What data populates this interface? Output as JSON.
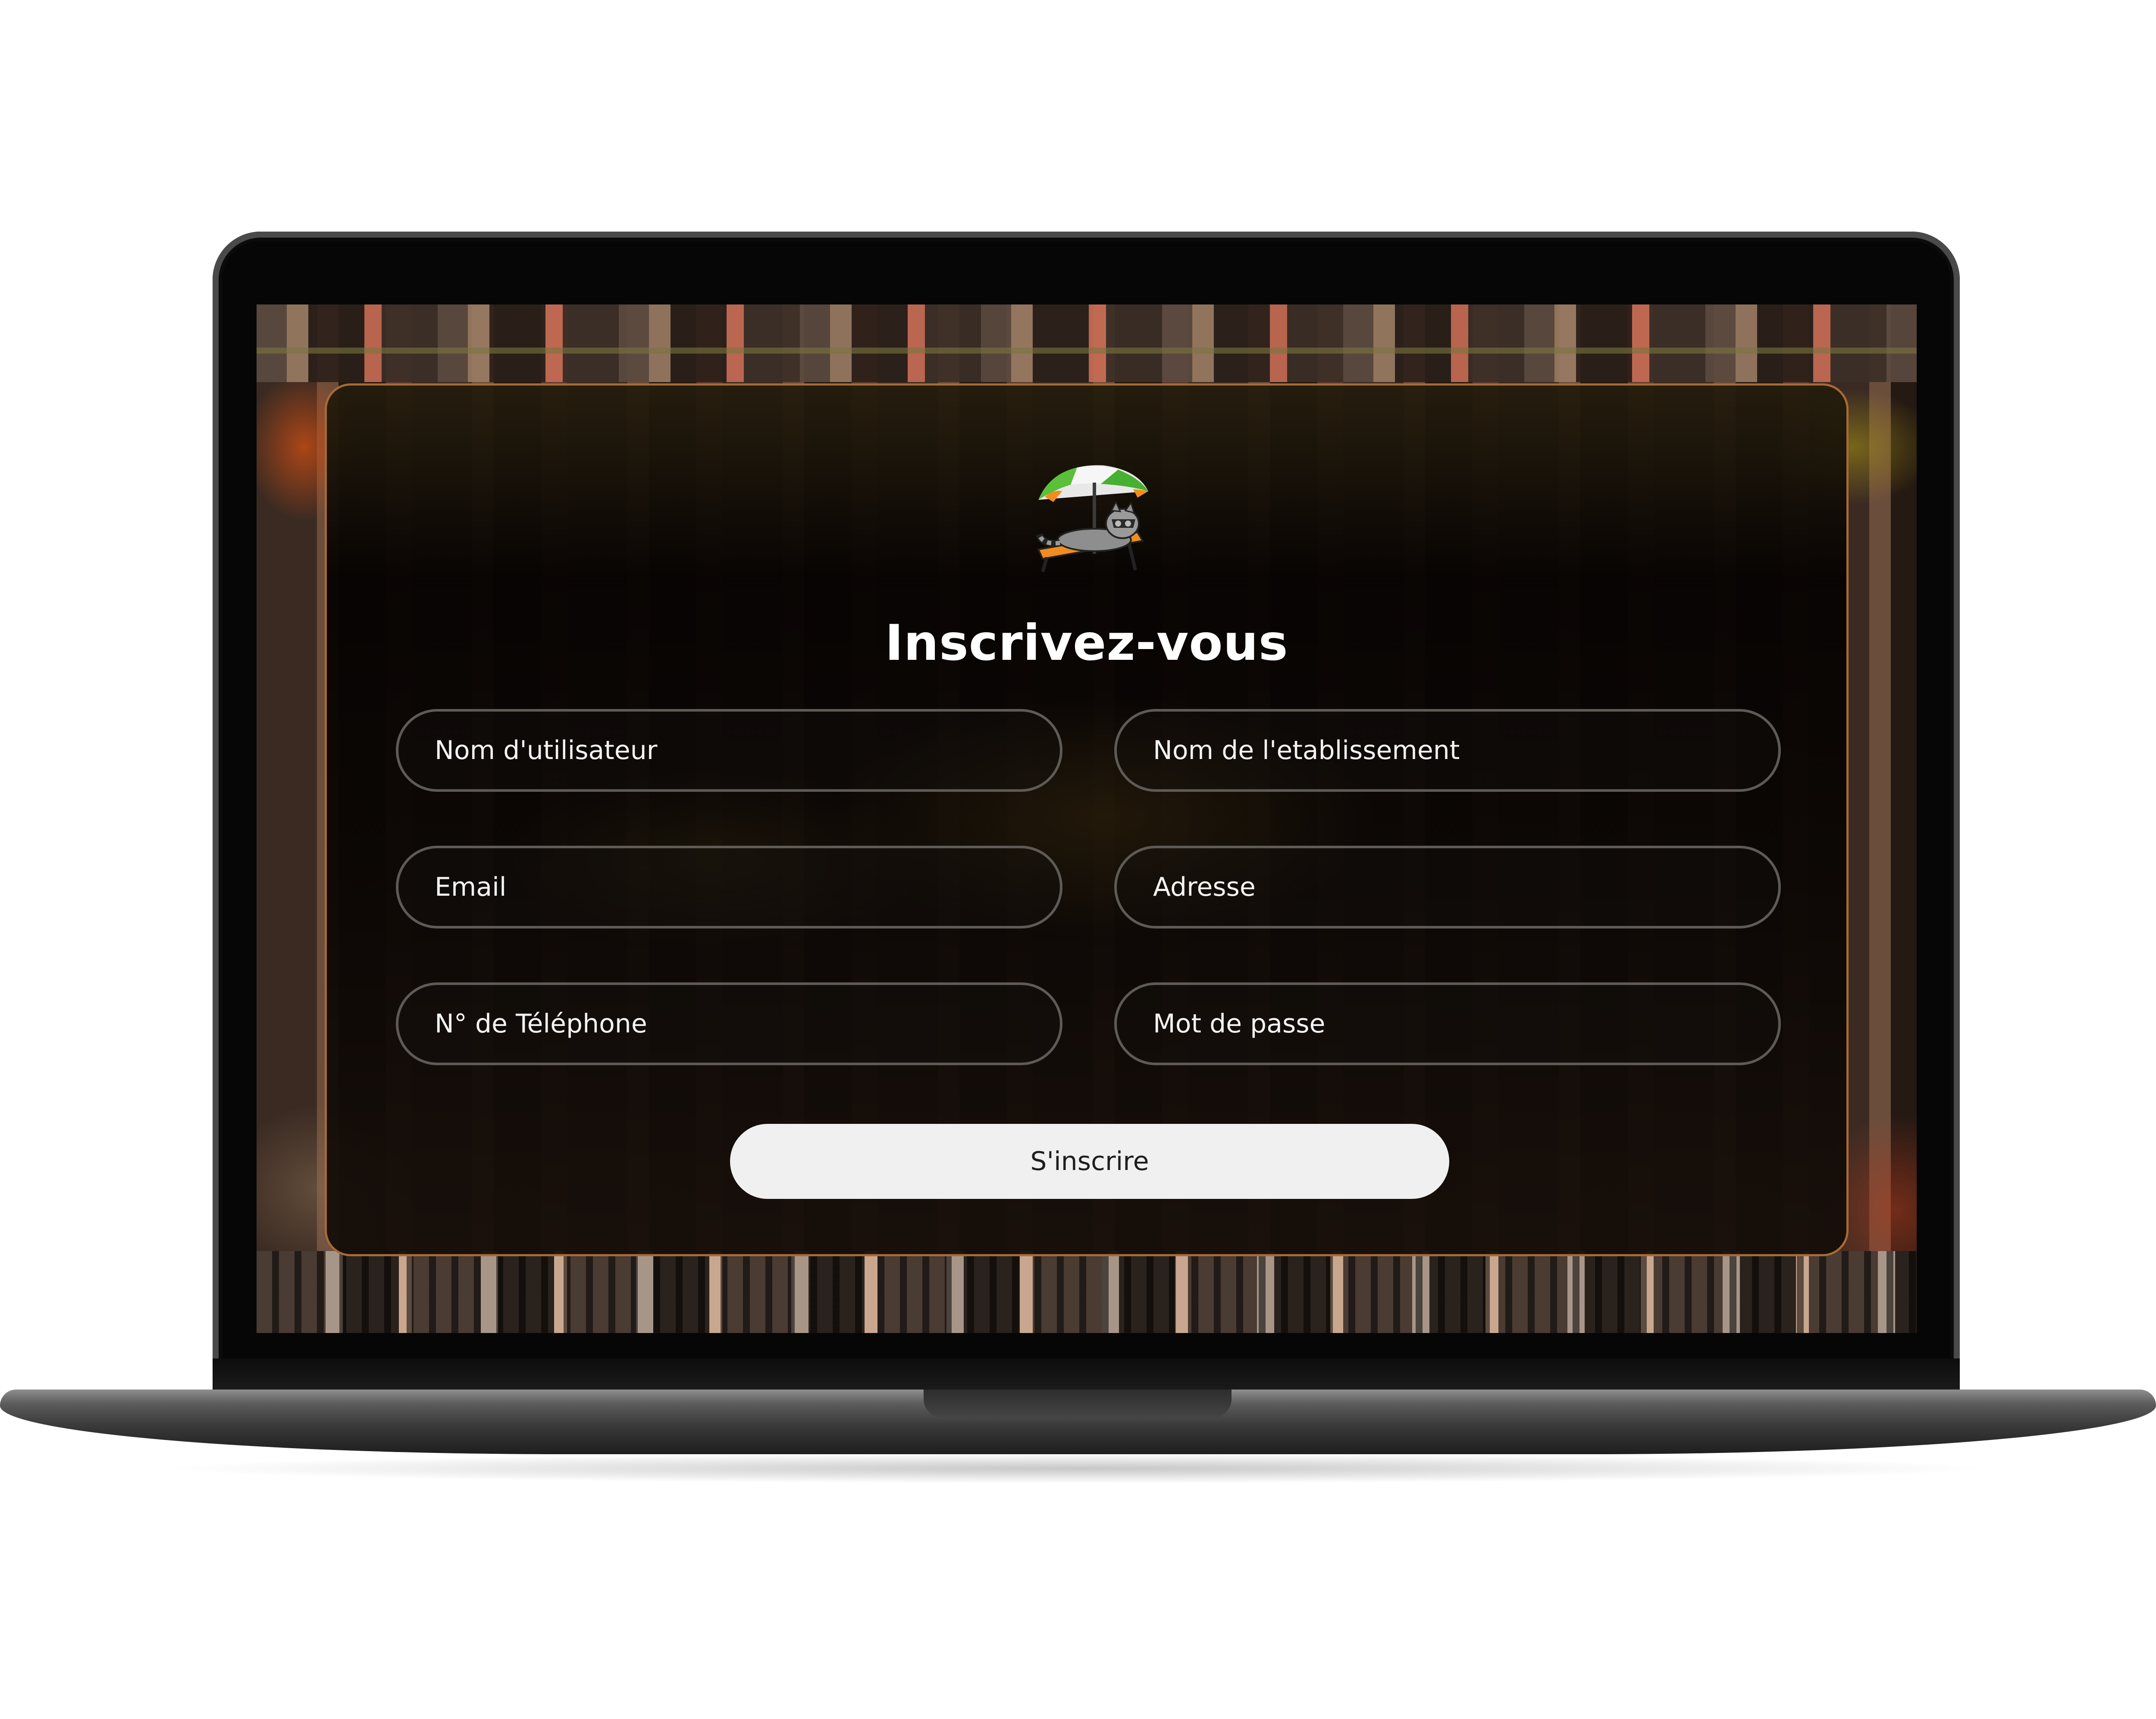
{
  "page": {
    "title": "Inscrivez-vous",
    "logo_icon": "raccoon-on-beach-chair-logo"
  },
  "form": {
    "fields": [
      {
        "name": "username",
        "placeholder": "Nom d'utilisateur",
        "value": ""
      },
      {
        "name": "establishment",
        "placeholder": "Nom de l'etablissement",
        "value": ""
      },
      {
        "name": "email",
        "placeholder": "Email",
        "value": ""
      },
      {
        "name": "address",
        "placeholder": "Adresse",
        "value": ""
      },
      {
        "name": "phone",
        "placeholder": "N° de Téléphone",
        "value": ""
      },
      {
        "name": "password",
        "placeholder": "Mot de passe",
        "value": ""
      }
    ],
    "submit_label": "S'inscrire"
  },
  "colors": {
    "panel_border": "#a86a34",
    "field_border": "#5e5a55",
    "button_bg": "#f0f0f0",
    "title_text": "#ffffff"
  }
}
